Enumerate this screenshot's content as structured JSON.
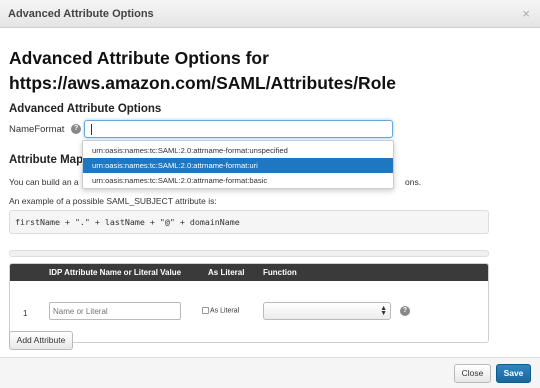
{
  "window": {
    "title": "Advanced Attribute Options",
    "close_glyph": "×"
  },
  "page": {
    "heading_line1": "Advanced Attribute Options for",
    "heading_line2": "https://aws.amazon.com/SAML/Attributes/Role"
  },
  "advanced": {
    "section_title": "Advanced Attribute Options",
    "nameformat_label": "NameFormat",
    "nameformat_value": "",
    "help_glyph": "?",
    "help_icon": "help-icon",
    "dropdown_options": [
      "urn:oasis:names:tc:SAML:2.0:attrname-format:unspecified",
      "urn:oasis:names:tc:SAML:2.0:attrname-format:uri",
      "urn:oasis:names:tc:SAML:2.0:attrname-format:basic"
    ],
    "selected_index": 1
  },
  "mapping": {
    "section_title_visible": "Attribute Mapp",
    "description_start": "You can build an a",
    "description_end": "ons.",
    "example_intro": "An example of a possible SAML_SUBJECT attribute is:",
    "example_code": "firstName + \".\" + lastName + \"@\" + domainName"
  },
  "table": {
    "headers": [
      "IDP Attribute Name or Literal Value",
      "As Literal",
      "Function"
    ],
    "rows": [
      {
        "number": "1",
        "value_placeholder": "Name or Literal",
        "as_literal_label": "As Literal",
        "as_literal_checked": false,
        "function_value": ""
      }
    ]
  },
  "buttons": {
    "add_attribute": "Add Attribute",
    "close": "Close",
    "save": "Save"
  },
  "colors": {
    "accent": "#1f76c1",
    "save_button": "#2f86c2",
    "table_header": "#3a3a3a"
  }
}
